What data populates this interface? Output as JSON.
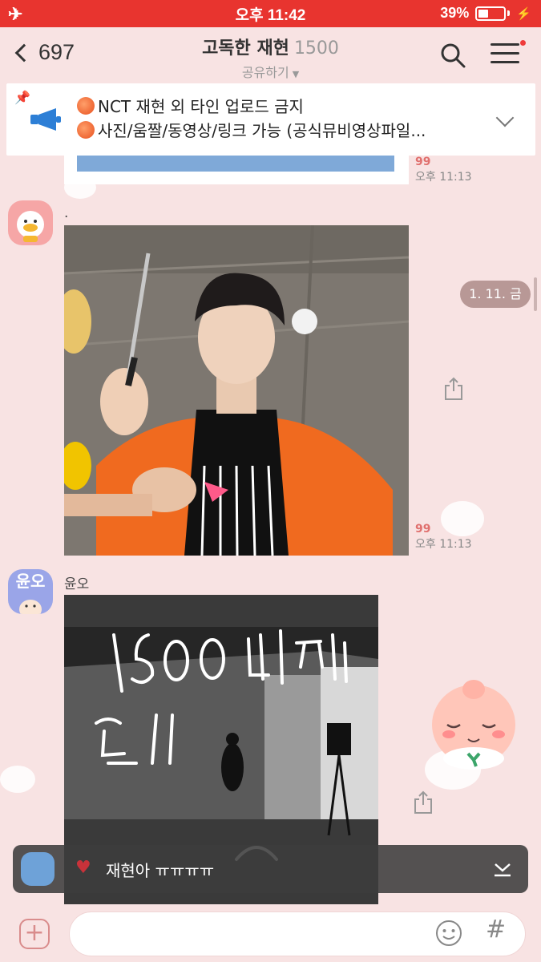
{
  "status_bar": {
    "time": "오후 11:42",
    "battery": "39%"
  },
  "header": {
    "back_count": "697",
    "title": "고독한 재현",
    "member_count": "1500",
    "subtitle": "공유하기"
  },
  "notice": {
    "line1": "NCT 재현 외 타인 업로드 금지",
    "line2": "사진/움짤/동영상/링크 가능 (공식뮤비영상파일..."
  },
  "messages": [
    {
      "unread": "99",
      "time": "오후 11:13"
    },
    {
      "sender": ".",
      "unread": "99",
      "time": "오후 11:13"
    },
    {
      "sender": "윤오",
      "avatar_text": "윤오"
    }
  ],
  "date_pill": "1. 11. 금",
  "reply": {
    "text": "재현아 ㅠㅠㅠㅠ"
  },
  "input": {
    "placeholder": ""
  },
  "colors": {
    "status_bar": "#e8342f",
    "background": "#f8e3e3",
    "unread": "#e0706e"
  }
}
